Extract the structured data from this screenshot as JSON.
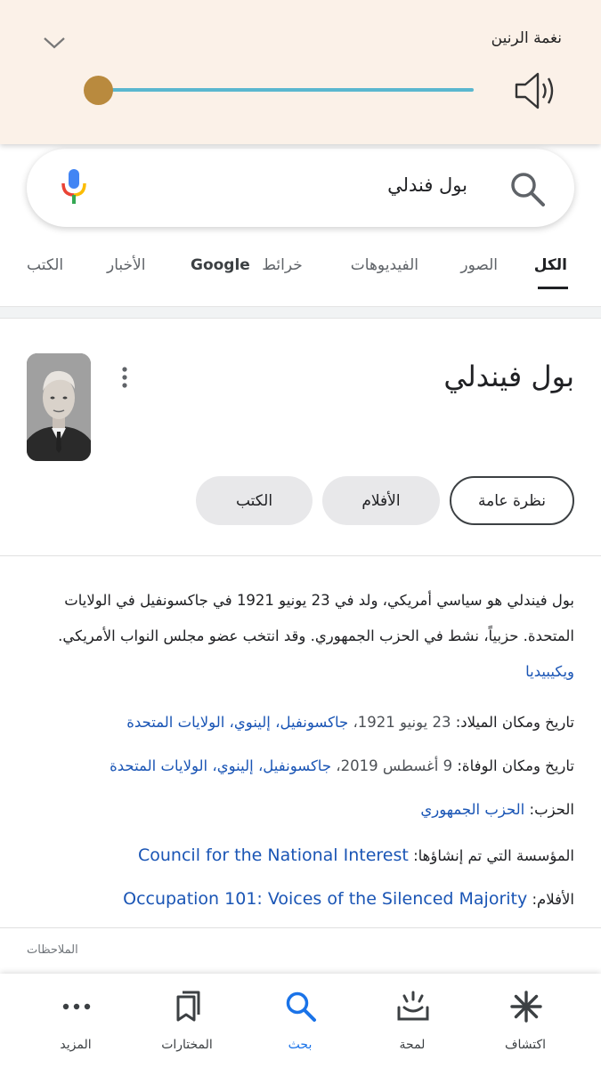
{
  "ringtone_panel": {
    "title": "نغمة الرنين",
    "volume_level": 0.0,
    "icons": [
      "chevron-down-icon",
      "speaker-icon"
    ]
  },
  "search": {
    "query": "بول فندلي",
    "icons": [
      "mic-icon",
      "search-icon"
    ]
  },
  "tabs": [
    {
      "label": "الكل",
      "active": true
    },
    {
      "label": "الصور"
    },
    {
      "label": "الفيديوهات"
    },
    {
      "label": "خرائط"
    },
    {
      "label": "Google"
    },
    {
      "label": "الأخبار"
    },
    {
      "label": "الكتب"
    }
  ],
  "knowledge_panel": {
    "title": "بول فيندلي",
    "chips": [
      "نظرة عامة",
      "الأفلام",
      "الكتب"
    ],
    "description": "بول فيندلي  هو سياسي أمريكي، ولد في 23 يونيو 1921 في جاكسونفيل في الولايات المتحدة. حزبياً، نشط في الحزب الجمهوري. وقد انتخب عضو مجلس النواب الأمريكي.",
    "source": "ويكيبيديا",
    "facts": {
      "birth": {
        "label": "تاريخ ومكان الميلاد:",
        "date": "23 يونيو 1921،",
        "place": "جاكسونفيل، إلينوي، الولايات المتحدة"
      },
      "death": {
        "label": "تاريخ ومكان الوفاة:",
        "date": "9 أغسطس 2019،",
        "place": "جاكسونفيل، إلينوي، الولايات المتحدة"
      },
      "party": {
        "label": "الحزب:",
        "value": "الحزب الجمهوري"
      },
      "org": {
        "label": "المؤسسة التي تم إنشاؤها:",
        "value": "Council for the National Interest"
      },
      "films": {
        "label": "الأفلام:",
        "value": "Occupation 101: Voices of the Silenced Majority"
      }
    },
    "notes": "الملاحظات"
  },
  "bottom_nav": [
    {
      "label": "اكتشاف",
      "icon": "asterisk-icon"
    },
    {
      "label": "لمحة",
      "icon": "snapshot-icon"
    },
    {
      "label": "بحث",
      "icon": "search-icon",
      "active": true
    },
    {
      "label": "المختارات",
      "icon": "bookmarks-icon"
    },
    {
      "label": "المزيد",
      "icon": "more-icon"
    }
  ],
  "colors": {
    "ring_bg": "#fbf1e8",
    "slider_track": "#5ab7cf",
    "slider_thumb": "#b98a3e",
    "link": "#1a55b5",
    "active_blue": "#1a73e8"
  }
}
